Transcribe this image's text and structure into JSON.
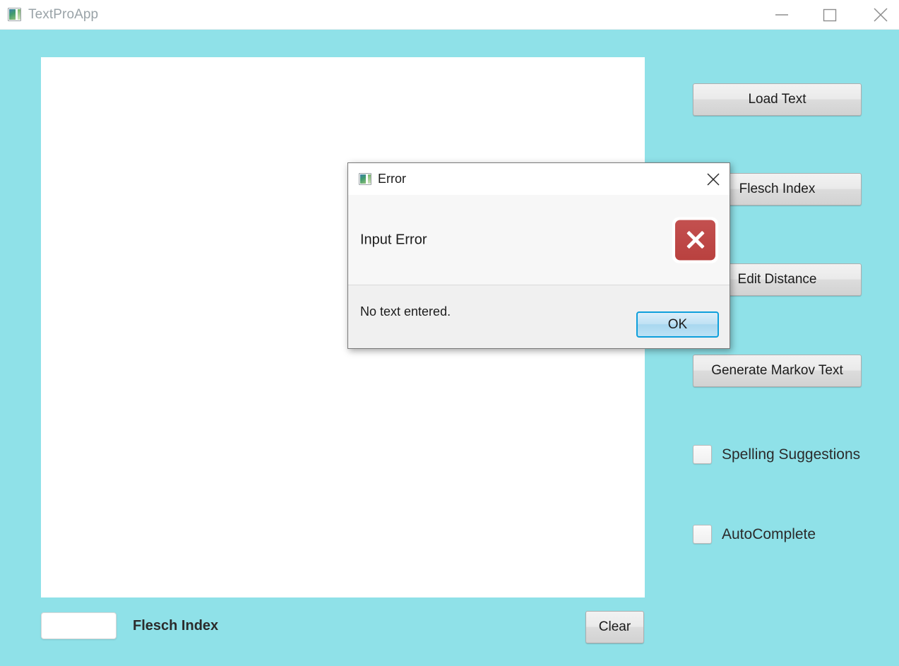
{
  "window": {
    "title": "TextProApp",
    "icon": "app-window-icon",
    "controls": {
      "minimize": "minimize-icon",
      "maximize": "maximize-icon",
      "close": "close-icon"
    },
    "background_color": "#8fe1e8"
  },
  "editor": {
    "value": "",
    "placeholder": ""
  },
  "actions": {
    "load_text": "Load Text",
    "flesch_index": "Flesch Index",
    "edit_distance": "Edit Distance",
    "generate_markov": "Generate Markov Text",
    "clear": "Clear"
  },
  "options": [
    {
      "label": "Spelling Suggestions",
      "checked": false
    },
    {
      "label": "AutoComplete",
      "checked": false
    }
  ],
  "status_bar": {
    "flesch_value": "",
    "flesch_label": "Flesch Index"
  },
  "dialog": {
    "title": "Error",
    "icon": "app-window-icon",
    "close_icon": "close-icon",
    "heading": "Input Error",
    "severity_icon": "error-x-icon",
    "severity_color": "#be4543",
    "message": "No text entered.",
    "ok_label": "OK",
    "accent_color": "#0f9fdb"
  }
}
